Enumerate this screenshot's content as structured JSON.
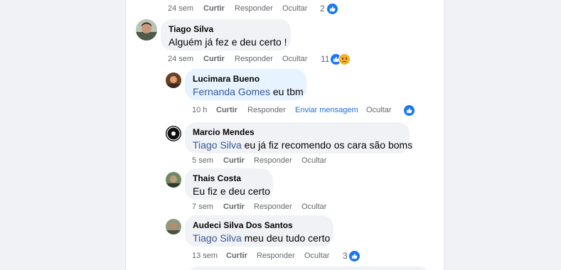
{
  "comments": [
    {
      "age": "24 sem",
      "like": "Curtir",
      "reply": "Responder",
      "hide": "Ocultar",
      "reactions": "2"
    },
    {
      "author": "Tiago Silva",
      "text": "Alguém já fez e deu certo !",
      "age": "24 sem",
      "like": "Curtir",
      "reply": "Responder",
      "hide": "Ocultar",
      "reactions": "11"
    }
  ],
  "replies": [
    {
      "author": "Lucimara Bueno",
      "mention": "Fernanda Gomes",
      "text": " eu tbm",
      "age": "10 h",
      "like": "Curtir",
      "reply": "Responder",
      "message": "Enviar mensagem",
      "hide": "Ocultar"
    },
    {
      "author": "Marcio Mendes",
      "mention": "Tiago Silva",
      "text": " eu já fiz recomendo os cara são boms",
      "age": "5 sem",
      "like": "Curtir",
      "reply": "Responder",
      "hide": "Ocultar"
    },
    {
      "author": "Thais Costa",
      "text": "Eu fiz e deu certo",
      "age": "7 sem",
      "like": "Curtir",
      "reply": "Responder",
      "hide": "Ocultar"
    },
    {
      "author": "Audeci Silva Dos Santos",
      "mention": "Tiago Silva",
      "text": " meu deu tudo certo",
      "age": "13 sem",
      "like": "Curtir",
      "reply": "Responder",
      "hide": "Ocultar",
      "reactions": "3"
    }
  ],
  "icons": {
    "like": "like-icon",
    "sad": "sad-reaction-icon"
  },
  "colors": {
    "mention": "#385898",
    "link": "#216fdb",
    "like": "#1877f2"
  }
}
